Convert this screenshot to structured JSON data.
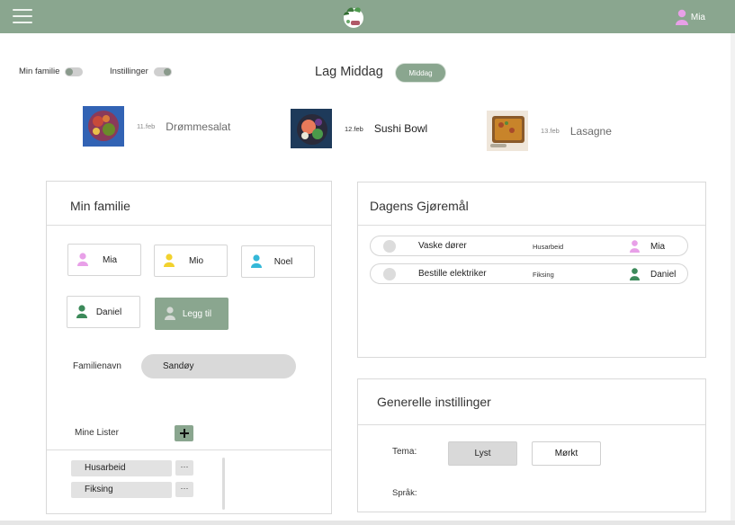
{
  "header": {
    "user_name": "Mia",
    "colors": {
      "bar": "#8aa68f"
    }
  },
  "settings": {
    "toggles": [
      {
        "label": "Min familie",
        "on": false
      },
      {
        "label": "Instillinger",
        "on": true
      }
    ]
  },
  "dinner": {
    "title": "Lag Middag",
    "button_label": "Middag",
    "meals": [
      {
        "date": "11.feb",
        "name": "Drømmesalat",
        "active": false
      },
      {
        "date": "12.feb",
        "name": "Sushi Bowl",
        "active": true
      },
      {
        "date": "13.feb",
        "name": "Lasagne",
        "active": false
      }
    ]
  },
  "family_panel": {
    "title": "Min familie",
    "members": [
      {
        "name": "Mia",
        "color": "#e8a0e8"
      },
      {
        "name": "Mio",
        "color": "#f2d22e"
      },
      {
        "name": "Noel",
        "color": "#34b8d8"
      },
      {
        "name": "Daniel",
        "color": "#3c8a5a"
      }
    ],
    "add_label": "Legg til",
    "family_name_label": "Familienavn",
    "family_name_value": "Sandøy",
    "lists_label": "Mine Lister",
    "lists": [
      {
        "name": "Husarbeid",
        "menu": "···"
      },
      {
        "name": "Fiksing",
        "menu": "···"
      }
    ]
  },
  "chores_panel": {
    "title": "Dagens Gjøremål",
    "chores": [
      {
        "title": "Vaske dører",
        "category": "Husarbeid",
        "assignee": "Mia",
        "color": "#e8a0e8"
      },
      {
        "title": "Bestille elektriker",
        "category": "Fiksing",
        "assignee": "Daniel",
        "color": "#3c8a5a"
      }
    ]
  },
  "general_settings": {
    "title": "Generelle instillinger",
    "theme_label": "Tema:",
    "theme_light": "Lyst",
    "theme_dark": "Mørkt",
    "language_label": "Språk:"
  }
}
